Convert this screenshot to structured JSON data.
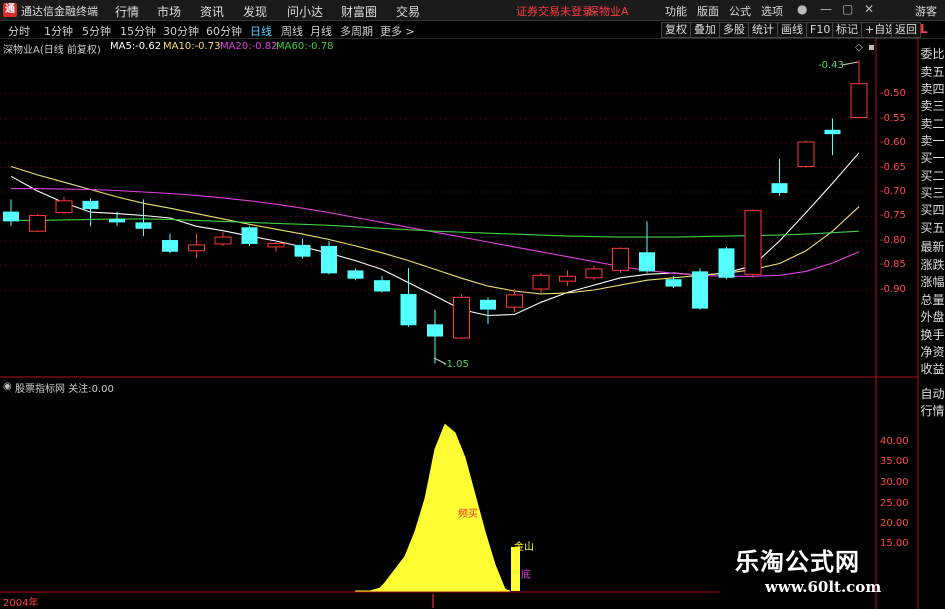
{
  "titlebar": {
    "app_name": "通达信金融终端",
    "menus": [
      "行情",
      "市场",
      "资讯",
      "发现",
      "问小达",
      "财富圈",
      "交易"
    ],
    "warning": "证券交易未登录",
    "stock": "深物业A",
    "right_menus": [
      "功能",
      "版面",
      "公式",
      "选项"
    ],
    "guest": "游客"
  },
  "periods": [
    "分时",
    "1分钟",
    "5分钟",
    "15分钟",
    "30分钟",
    "60分钟",
    "日线",
    "周线",
    "月线",
    "多周期",
    "更多 >"
  ],
  "active_period": "日线",
  "toolbar": [
    "复权",
    "叠加",
    "多股",
    "统计",
    "画线",
    "F10",
    "标记",
    "+自选",
    "返回"
  ],
  "right_panel": {
    "top_label": "L",
    "items": [
      "委比",
      "卖五",
      "卖四",
      "卖三",
      "卖二",
      "卖一",
      "买一",
      "买二",
      "买三",
      "买四",
      "买五",
      "最新",
      "涨跌",
      "涨幅",
      "总量",
      "外盘",
      "换手",
      "净资",
      "收益"
    ],
    "bottom_items": [
      "自动",
      "行情"
    ]
  },
  "main_chart": {
    "title": "深物业A(日线 前复权)",
    "ma": [
      {
        "label": "MA5:",
        "value": "-0.62",
        "color": "#ffffff"
      },
      {
        "label": "MA10:",
        "value": "-0.73",
        "color": "#f0e070"
      },
      {
        "label": "MA20:",
        "value": "-0.82",
        "color": "#e040e0"
      },
      {
        "label": "MA60:",
        "value": "-0.78",
        "color": "#40d040"
      }
    ],
    "high_label": "-0.43",
    "low_label": "-1.05",
    "y_ticks": [
      "-0.50",
      "-0.55",
      "-0.60",
      "-0.65",
      "-0.70",
      "-0.75",
      "-0.80",
      "-0.85",
      "-0.90"
    ]
  },
  "chart_data": [
    {
      "type": "candlestick",
      "title": "深物业A(日线 前复权)",
      "y_axis_ticks": [
        -0.5,
        -0.55,
        -0.6,
        -0.65,
        -0.7,
        -0.75,
        -0.8,
        -0.85,
        -0.9
      ],
      "candles": [
        {
          "o": -0.74,
          "c": -0.76,
          "h": -0.715,
          "l": -0.77
        },
        {
          "o": -0.78,
          "c": -0.748,
          "h": -0.745,
          "l": -0.782
        },
        {
          "o": -0.742,
          "c": -0.718,
          "h": -0.71,
          "l": -0.745
        },
        {
          "o": -0.718,
          "c": -0.735,
          "h": -0.713,
          "l": -0.77
        },
        {
          "o": -0.755,
          "c": -0.762,
          "h": -0.74,
          "l": -0.77
        },
        {
          "o": -0.762,
          "c": -0.775,
          "h": -0.715,
          "l": -0.79
        },
        {
          "o": -0.798,
          "c": -0.822,
          "h": -0.785,
          "l": -0.825
        },
        {
          "o": -0.82,
          "c": -0.808,
          "h": -0.785,
          "l": -0.835
        },
        {
          "o": -0.806,
          "c": -0.792,
          "h": -0.782,
          "l": -0.81
        },
        {
          "o": -0.772,
          "c": -0.806,
          "h": -0.77,
          "l": -0.81
        },
        {
          "o": -0.812,
          "c": -0.805,
          "h": -0.8,
          "l": -0.822
        },
        {
          "o": -0.808,
          "c": -0.832,
          "h": -0.796,
          "l": -0.836
        },
        {
          "o": -0.81,
          "c": -0.866,
          "h": -0.8,
          "l": -0.868
        },
        {
          "o": -0.86,
          "c": -0.877,
          "h": -0.856,
          "l": -0.88
        },
        {
          "o": -0.88,
          "c": -0.903,
          "h": -0.872,
          "l": -0.905
        },
        {
          "o": -0.908,
          "c": -0.972,
          "h": -0.855,
          "l": -0.975
        },
        {
          "o": -0.97,
          "c": -0.995,
          "h": -0.94,
          "l": -1.05
        },
        {
          "o": -0.998,
          "c": -0.915,
          "h": -0.908,
          "l": -1.0
        },
        {
          "o": -0.92,
          "c": -0.94,
          "h": -0.915,
          "l": -0.97
        },
        {
          "o": -0.935,
          "c": -0.91,
          "h": -0.898,
          "l": -0.945
        },
        {
          "o": -0.898,
          "c": -0.87,
          "h": -0.865,
          "l": -0.905
        },
        {
          "o": -0.882,
          "c": -0.872,
          "h": -0.86,
          "l": -0.892
        },
        {
          "o": -0.875,
          "c": -0.857,
          "h": -0.85,
          "l": -0.88
        },
        {
          "o": -0.86,
          "c": -0.815,
          "h": -0.813,
          "l": -0.865
        },
        {
          "o": -0.823,
          "c": -0.862,
          "h": -0.76,
          "l": -0.865
        },
        {
          "o": -0.878,
          "c": -0.893,
          "h": -0.872,
          "l": -0.896
        },
        {
          "o": -0.862,
          "c": -0.938,
          "h": -0.855,
          "l": -0.94
        },
        {
          "o": -0.815,
          "c": -0.875,
          "h": -0.812,
          "l": -0.878
        },
        {
          "o": -0.868,
          "c": -0.738,
          "h": -0.735,
          "l": -0.875
        },
        {
          "o": -0.682,
          "c": -0.702,
          "h": -0.632,
          "l": -0.708
        },
        {
          "o": -0.648,
          "c": -0.598,
          "h": -0.595,
          "l": -0.65
        },
        {
          "o": -0.573,
          "c": -0.582,
          "h": -0.55,
          "l": -0.625
        },
        {
          "o": -0.548,
          "c": -0.479,
          "h": -0.43,
          "l": -0.55
        }
      ],
      "series": [
        {
          "name": "MA5",
          "color": "#ffffff",
          "values": [
            -0.668,
            -0.698,
            -0.722,
            -0.741,
            -0.744,
            -0.748,
            -0.753,
            -0.77,
            -0.779,
            -0.79,
            -0.8,
            -0.812,
            -0.825,
            -0.84,
            -0.858,
            -0.885,
            -0.912,
            -0.94,
            -0.952,
            -0.95,
            -0.925,
            -0.905,
            -0.89,
            -0.875,
            -0.868,
            -0.865,
            -0.87,
            -0.865,
            -0.85,
            -0.8,
            -0.742,
            -0.682,
            -0.62
          ]
        },
        {
          "name": "MA10",
          "color": "#f0e070",
          "values": [
            -0.648,
            -0.665,
            -0.68,
            -0.695,
            -0.71,
            -0.723,
            -0.733,
            -0.744,
            -0.755,
            -0.766,
            -0.776,
            -0.786,
            -0.797,
            -0.81,
            -0.824,
            -0.84,
            -0.858,
            -0.876,
            -0.892,
            -0.902,
            -0.908,
            -0.906,
            -0.9,
            -0.89,
            -0.88,
            -0.875,
            -0.87,
            -0.866,
            -0.858,
            -0.846,
            -0.82,
            -0.78,
            -0.73
          ]
        },
        {
          "name": "MA20",
          "color": "#e040e0",
          "values": [
            -0.693,
            -0.693,
            -0.694,
            -0.695,
            -0.697,
            -0.7,
            -0.703,
            -0.707,
            -0.712,
            -0.718,
            -0.725,
            -0.733,
            -0.742,
            -0.752,
            -0.762,
            -0.772,
            -0.782,
            -0.792,
            -0.802,
            -0.812,
            -0.822,
            -0.832,
            -0.842,
            -0.852,
            -0.86,
            -0.866,
            -0.87,
            -0.872,
            -0.872,
            -0.87,
            -0.862,
            -0.845,
            -0.822
          ]
        },
        {
          "name": "MA60",
          "color": "#40d040",
          "values": [
            -0.758,
            -0.758,
            -0.757,
            -0.756,
            -0.755,
            -0.755,
            -0.756,
            -0.758,
            -0.76,
            -0.762,
            -0.764,
            -0.766,
            -0.768,
            -0.771,
            -0.774,
            -0.777,
            -0.78,
            -0.782,
            -0.784,
            -0.786,
            -0.788,
            -0.79,
            -0.791,
            -0.792,
            -0.792,
            -0.792,
            -0.791,
            -0.79,
            -0.789,
            -0.788,
            -0.786,
            -0.783,
            -0.78
          ]
        }
      ]
    },
    {
      "type": "area",
      "title": "股票指标网",
      "y_axis_ticks": [
        40.0,
        35.0,
        30.0,
        25.0,
        20.0,
        15.0
      ],
      "x": [
        355,
        360,
        370,
        380,
        385,
        395,
        405,
        415,
        425,
        435,
        445,
        455,
        465,
        475,
        485,
        495,
        505,
        510
      ],
      "values": [
        0.4,
        1.0,
        2.6,
        4.3,
        5.6,
        8.8,
        12.0,
        18.0,
        26.0,
        38.0,
        44.0,
        42.0,
        36.0,
        27.0,
        18.0,
        10.0,
        4.0,
        1.0
      ],
      "color": "#ffff33"
    }
  ],
  "sub_chart": {
    "title": "股票指标网",
    "follow_label": "关注:",
    "follow_value": "0.00",
    "label_buy": "频买",
    "label_mountain": "金山",
    "label_low": "底",
    "y_ticks": [
      "40.00",
      "35.00",
      "30.00",
      "25.00",
      "20.00",
      "15.00"
    ]
  },
  "bottom": {
    "year": "2004年"
  },
  "watermark": {
    "cn": "乐淘公式网",
    "url": "www.60lt.com"
  }
}
